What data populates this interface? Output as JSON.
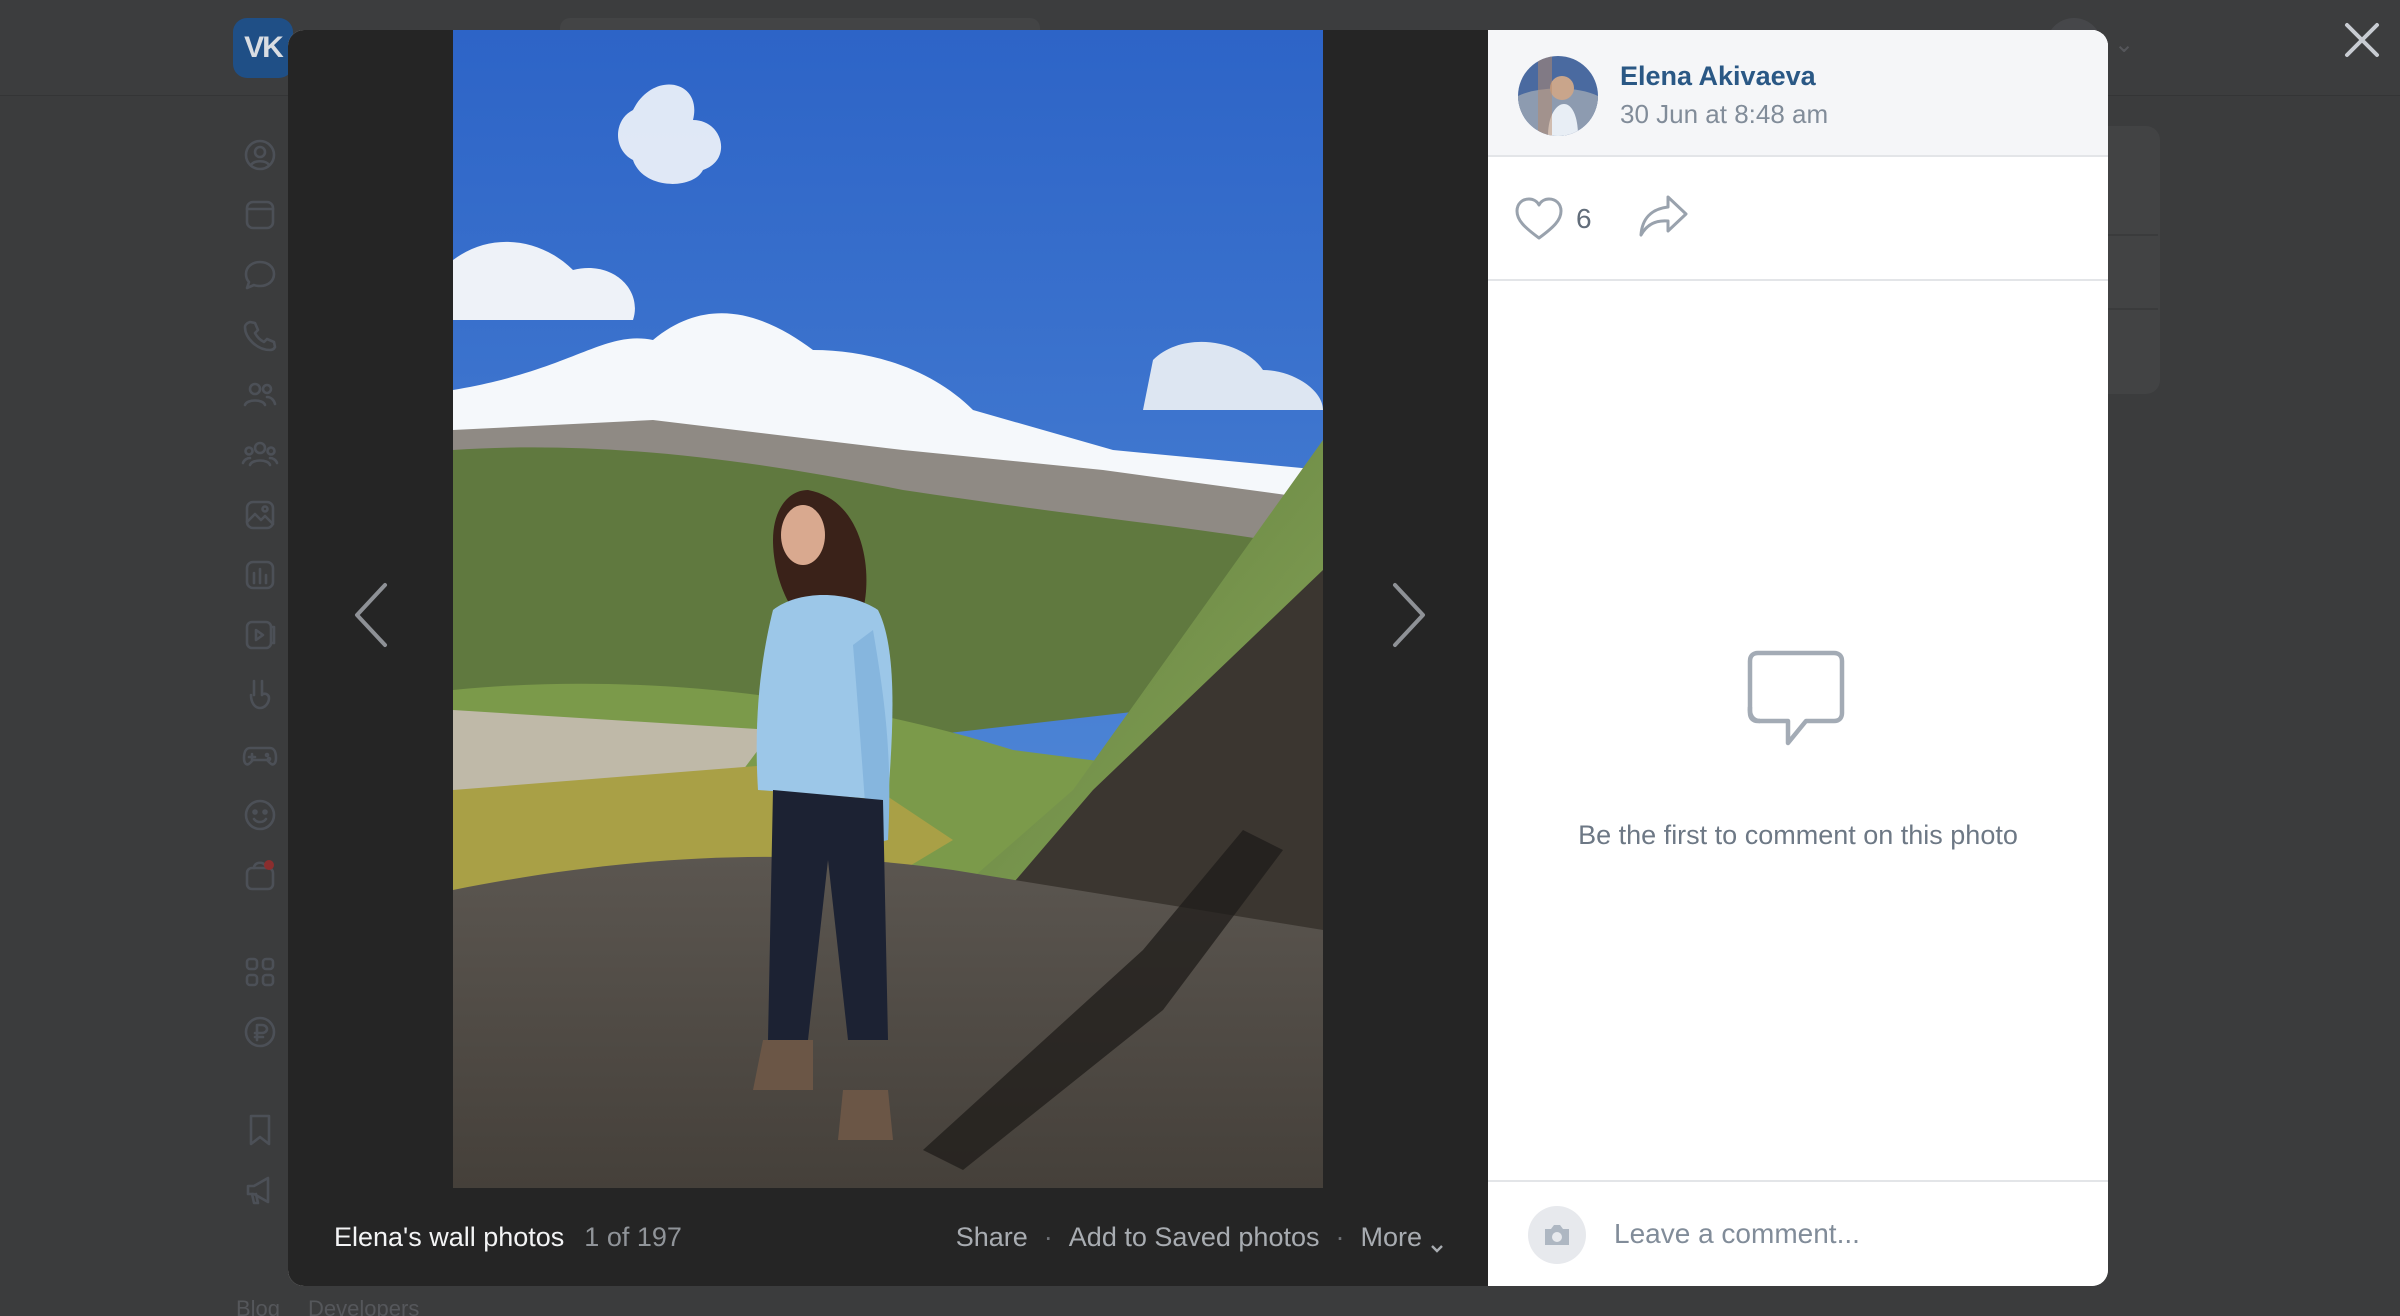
{
  "background_page": {
    "logo_text": "VK",
    "footer_links": [
      "Blog",
      "Developers"
    ]
  },
  "viewer": {
    "album_title": "Elena's wall photos",
    "counter": "1 of 197",
    "actions": {
      "share": "Share",
      "save": "Add to Saved photos",
      "more": "More"
    },
    "separator": "·"
  },
  "post": {
    "author": "Elena Akivaeva",
    "date": "30 Jun at 8:48 am",
    "likes": "6"
  },
  "comments": {
    "empty_text": "Be the first to comment on this photo",
    "input_placeholder": "Leave a comment..."
  },
  "colors": {
    "accent": "#2a5885",
    "overlay": "#252525"
  }
}
